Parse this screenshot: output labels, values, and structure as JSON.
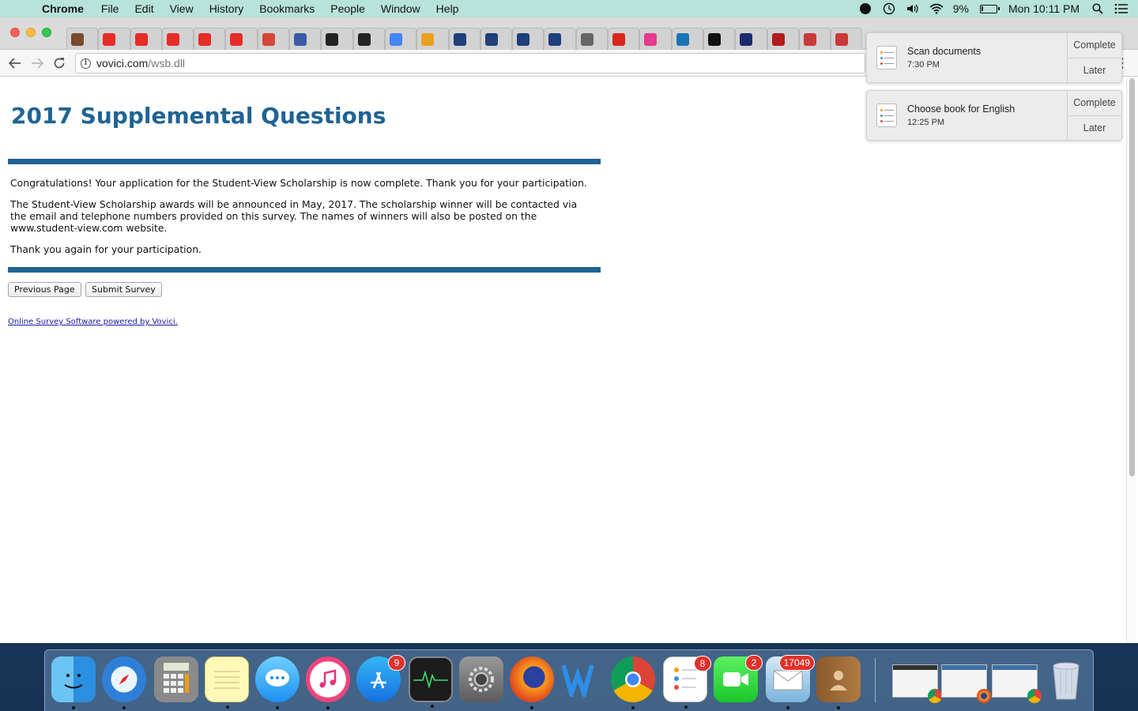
{
  "menubar": {
    "app": "Chrome",
    "items": [
      "File",
      "Edit",
      "View",
      "History",
      "Bookmarks",
      "People",
      "Window",
      "Help"
    ],
    "battery": "9%",
    "clock": "Mon 10:11 PM"
  },
  "browser": {
    "url_host": "vovici.com",
    "url_path": "/wsb.dll",
    "tabs": [
      {
        "icon": "film-icon",
        "color": "#7a4b2a"
      },
      {
        "icon": "youtube-icon",
        "color": "#e52d27"
      },
      {
        "icon": "youtube-icon",
        "color": "#e52d27"
      },
      {
        "icon": "youtube-icon",
        "color": "#e52d27"
      },
      {
        "icon": "youtube-icon",
        "color": "#e52d27"
      },
      {
        "icon": "youtube-icon",
        "color": "#e52d27"
      },
      {
        "icon": "gmail-icon",
        "color": "#d44638"
      },
      {
        "icon": "b-icon",
        "color": "#3b5aa8"
      },
      {
        "icon": "amazon-icon",
        "color": "#222222"
      },
      {
        "icon": "amazon-icon",
        "color": "#222222"
      },
      {
        "icon": "google-icon",
        "color": "#4285f4"
      },
      {
        "icon": "dh-icon",
        "color": "#e8a21d"
      },
      {
        "icon": "bag-icon",
        "color": "#1e3f7a"
      },
      {
        "icon": "bag-icon",
        "color": "#1e3f7a"
      },
      {
        "icon": "bag-icon",
        "color": "#1e3f7a"
      },
      {
        "icon": "bag-icon",
        "color": "#1e3f7a"
      },
      {
        "icon": "dsw-icon",
        "color": "#666666"
      },
      {
        "icon": "g-icon",
        "color": "#d9261c"
      },
      {
        "icon": "o-icon",
        "color": "#e23b8f"
      },
      {
        "icon": "fw-icon",
        "color": "#1a73b7"
      },
      {
        "icon": "do-icon",
        "color": "#111111"
      },
      {
        "icon": "star-icon",
        "color": "#1b2b6b"
      },
      {
        "icon": "red-icon",
        "color": "#b01c1c"
      },
      {
        "icon": "ribbon-icon",
        "color": "#c83a3a"
      },
      {
        "icon": "ribbon-icon",
        "color": "#c83a3a"
      }
    ]
  },
  "page": {
    "title": "2017 Supplemental Questions",
    "para1": "Congratulations! Your application for the Student-View Scholarship is now complete. Thank you for your participation.",
    "para2": "The Student-View Scholarship awards will be announced in May, 2017. The scholarship winner will be contacted via the email and telephone numbers provided on this survey. The names of winners will also be posted on the www.student-view.com website.",
    "para3": "Thank you again for your participation.",
    "prev_button": "Previous Page",
    "submit_button": "Submit Survey",
    "footer_link": "Online Survey Software powered by Vovici."
  },
  "notifications": [
    {
      "title": "Scan documents",
      "time": "7:30 PM",
      "complete": "Complete",
      "later": "Later"
    },
    {
      "title": "Choose book for English",
      "time": "12:25 PM",
      "complete": "Complete",
      "later": "Later"
    }
  ],
  "dock": {
    "badges": {
      "appstore": "9",
      "reminders": "8",
      "facetime": "2",
      "mail": "17049"
    }
  }
}
